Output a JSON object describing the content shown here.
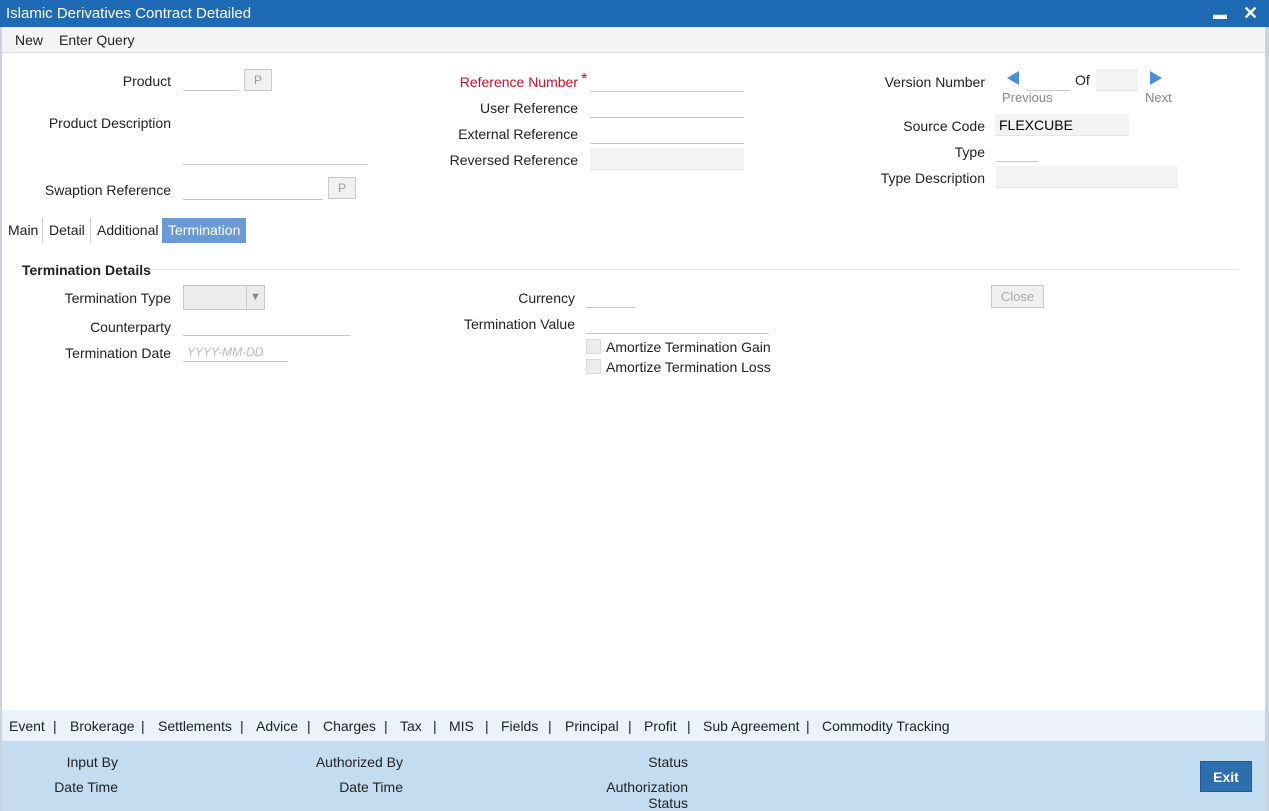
{
  "window": {
    "title": "Islamic Derivatives Contract Detailed",
    "minimize": "▬",
    "close": "✕"
  },
  "menu": {
    "new": "New",
    "enter_query": "Enter Query"
  },
  "header": {
    "product_label": "Product",
    "product_value": "",
    "p_button": "P",
    "product_description_label": "Product Description",
    "product_description_value": "",
    "swaption_reference_label": "Swaption Reference",
    "swaption_reference_value": "",
    "reference_number_label": "Reference Number",
    "required_mark": "*",
    "reference_number_value": "",
    "user_reference_label": "User Reference",
    "user_reference_value": "",
    "external_reference_label": "External Reference",
    "external_reference_value": "",
    "reversed_reference_label": "Reversed Reference",
    "reversed_reference_value": "",
    "version_number_label": "Version Number",
    "version_value": "",
    "of_label": "Of",
    "version_total": "",
    "previous_label": "Previous",
    "next_label": "Next",
    "source_code_label": "Source Code",
    "source_code_value": "FLEXCUBE",
    "type_label": "Type",
    "type_value": "",
    "type_description_label": "Type Description",
    "type_description_value": ""
  },
  "tabs": [
    "Main",
    "Detail",
    "Additional",
    "Termination"
  ],
  "active_tab": "Termination",
  "termination": {
    "section_title": "Termination Details",
    "termination_type_label": "Termination Type",
    "termination_type_value": "",
    "counterparty_label": "Counterparty",
    "counterparty_value": "",
    "termination_date_label": "Termination Date",
    "termination_date_placeholder": "YYYY-MM-DD",
    "currency_label": "Currency",
    "currency_value": "",
    "termination_value_label": "Termination Value",
    "termination_value_value": "",
    "amortize_gain_label": "Amortize Termination Gain",
    "amortize_loss_label": "Amortize Termination Loss",
    "close_button": "Close"
  },
  "bottom_tabs": [
    "Event",
    "Brokerage",
    "Settlements",
    "Advice",
    "Charges",
    "Tax",
    "MIS",
    "Fields",
    "Principal",
    "Profit",
    "Sub Agreement",
    "Commodity Tracking"
  ],
  "bottom_separator": "|",
  "footer": {
    "input_by": "Input By",
    "date_time_1": "Date Time",
    "authorized_by": "Authorized By",
    "date_time_2": "Date Time",
    "status": "Status",
    "authorization_status_1": "Authorization",
    "authorization_status_2": "Status",
    "exit_button": "Exit"
  },
  "colors": {
    "title_bar": "#1f6ab5",
    "active_tab": "#6b9bd6",
    "required": "#c8102e",
    "footer": "#c3dcf0",
    "exit": "#2d6eae"
  }
}
